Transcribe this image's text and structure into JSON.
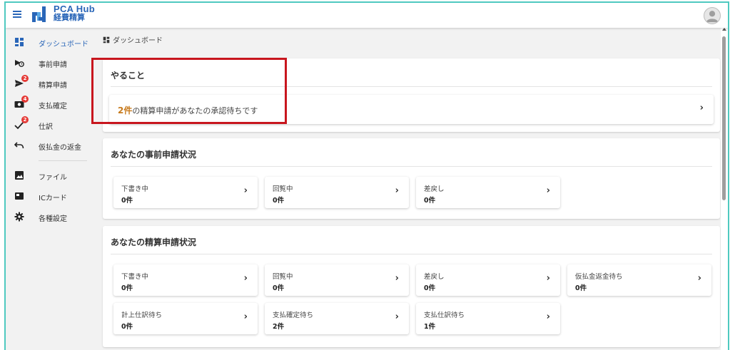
{
  "header": {
    "brand_line1": "PCA Hub",
    "brand_line2": "経費精算"
  },
  "sidebar": {
    "items": [
      {
        "label": "ダッシュボード",
        "icon": "dashboard-icon",
        "active": true
      },
      {
        "label": "事前申請",
        "icon": "pre-application-icon"
      },
      {
        "label": "精算申請",
        "icon": "send-icon",
        "badge": "2"
      },
      {
        "label": "支払確定",
        "icon": "payment-icon",
        "badge": "4"
      },
      {
        "label": "仕訳",
        "icon": "check-icon",
        "badge": "2"
      },
      {
        "label": "仮払金の返金",
        "icon": "undo-icon"
      },
      {
        "label": "ファイル",
        "icon": "image-file-icon"
      },
      {
        "label": "ICカード",
        "icon": "ic-card-icon"
      },
      {
        "label": "各種設定",
        "icon": "gear-icon"
      }
    ]
  },
  "breadcrumb": "ダッシュボード",
  "todo": {
    "title": "やること",
    "count": "2件",
    "message": "の精算申請があなたの承認待ちです"
  },
  "pre_status": {
    "title": "あなたの事前申請状況",
    "tiles": [
      {
        "label": "下書き中",
        "value": "0件"
      },
      {
        "label": "回覧中",
        "value": "0件"
      },
      {
        "label": "差戻し",
        "value": "0件"
      }
    ]
  },
  "settle_status": {
    "title": "あなたの精算申請状況",
    "tiles": [
      {
        "label": "下書き中",
        "value": "0件"
      },
      {
        "label": "回覧中",
        "value": "0件"
      },
      {
        "label": "差戻し",
        "value": "0件"
      },
      {
        "label": "仮払金返金待ち",
        "value": "0件"
      },
      {
        "label": "計上仕訳待ち",
        "value": "0件"
      },
      {
        "label": "支払確定待ち",
        "value": "2件"
      },
      {
        "label": "支払仕訳待ち",
        "value": "1件"
      }
    ]
  },
  "colors": {
    "accent": "#2a66b8",
    "badge": "#e53935",
    "highlight": "#c8161e",
    "count": "#c77a1c"
  }
}
